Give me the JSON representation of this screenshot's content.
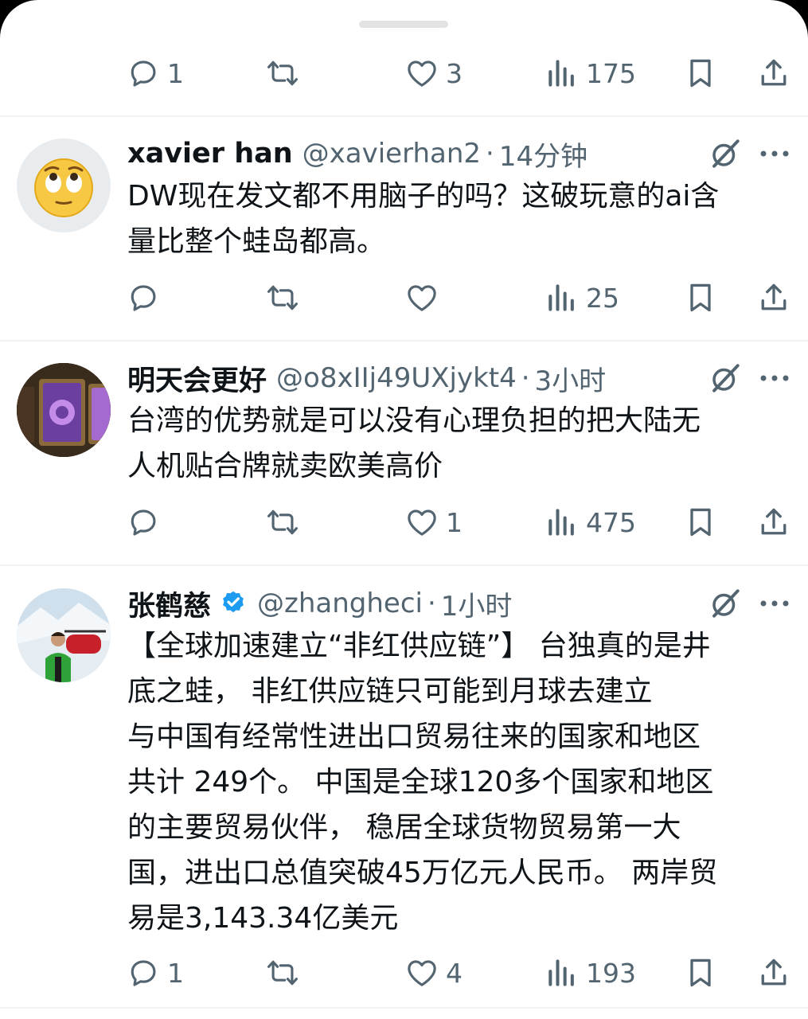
{
  "top_actions": {
    "reply_count": "1",
    "like_count": "3",
    "view_count": "175"
  },
  "posts": [
    {
      "name": "xavier han",
      "handle": "@xavierhan2",
      "separator": "·",
      "time": "14分钟",
      "text": "DW现在发文都不用脑子的吗？这破玩意的ai含\n量比整个蛙岛都高。",
      "reply_count": "",
      "like_count": "",
      "view_count": "25"
    },
    {
      "name": "明天会更好",
      "handle": "@o8xIIj49UXjykt4",
      "separator": "·",
      "time": "3小时",
      "text": "台湾的优势就是可以没有心理负担的把大陆无\n人机贴合牌就卖欧美高价",
      "reply_count": "",
      "like_count": "1",
      "view_count": "475"
    },
    {
      "name": "张鹤慈",
      "handle": "@zhangheci",
      "separator": "·",
      "time": "1小时",
      "verified": true,
      "text": "【全球加速建立“非红供应链”】 台独真的是井\n底之蛙， 非红供应链只可能到月球去建立\n与中国有经常性进出口贸易往来的国家和地区\n共计 249个。 中国是全球120多个国家和地区\n的主要贸易伙伴， 稳居全球货物贸易第一大\n国，进出口总值突破45万亿元人民币。 两岸贸\n易是3,143.34亿美元",
      "reply_count": "1",
      "like_count": "4",
      "view_count": "193"
    }
  ],
  "icons": {
    "reply": "reply-icon",
    "repost": "repost-icon",
    "like": "like-icon",
    "views": "views-icon",
    "bookmark": "bookmark-icon",
    "share": "share-icon",
    "grok": "grok-icon",
    "more": "more-icon",
    "verified": "verified-badge-icon"
  },
  "colors": {
    "text": "#0f1419",
    "secondary": "#536471",
    "verified": "#1d9bf0",
    "divider": "#eff3f4"
  }
}
